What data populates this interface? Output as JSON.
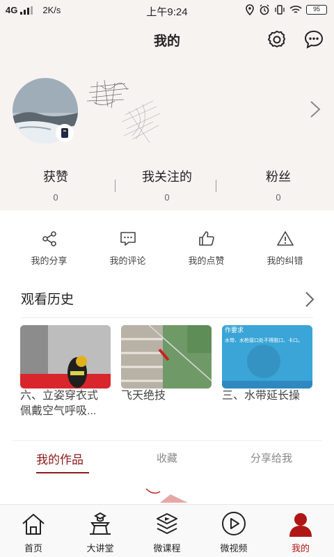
{
  "status_bar": {
    "network": "4G",
    "speed": "2K/s",
    "time": "上午9:24",
    "battery": "95"
  },
  "header": {
    "title": "我的",
    "icons": [
      "gear-icon",
      "message-icon"
    ]
  },
  "profile": {
    "stats": [
      {
        "label": "获赞",
        "value": "0"
      },
      {
        "label": "我关注的",
        "value": "0"
      },
      {
        "label": "粉丝",
        "value": "0"
      }
    ]
  },
  "actions": [
    {
      "label": "我的分享",
      "icon": "share-icon"
    },
    {
      "label": "我的评论",
      "icon": "comment-icon"
    },
    {
      "label": "我的点赞",
      "icon": "thumbs-up-icon"
    },
    {
      "label": "我的纠错",
      "icon": "warning-icon"
    }
  ],
  "history": {
    "title": "观看历史",
    "items": [
      {
        "title_line1": "六、立姿穿衣式",
        "title_line2": "佩戴空气呼吸..."
      },
      {
        "title_line1": "飞天绝技",
        "title_line2": ""
      },
      {
        "title_line1": "三、水带延长操",
        "title_line2": ""
      }
    ],
    "thumb_texts": [
      "作要求",
      "水带、水枪接口处不得脱口、卡口。"
    ]
  },
  "tabs": [
    {
      "label": "我的作品",
      "active": true
    },
    {
      "label": "收藏",
      "active": false
    },
    {
      "label": "分享给我",
      "active": false
    }
  ],
  "bottom_nav": [
    {
      "label": "首页",
      "icon": "home-icon",
      "active": false
    },
    {
      "label": "大讲堂",
      "icon": "lecture-hall-icon",
      "active": false
    },
    {
      "label": "微课程",
      "icon": "course-icon",
      "active": false
    },
    {
      "label": "微视频",
      "icon": "play-icon",
      "active": false
    },
    {
      "label": "我的",
      "icon": "user-icon",
      "active": true
    }
  ],
  "colors": {
    "accent": "#8b1a1a",
    "active_nav": "#b01515",
    "header_bg": "#f7f3f1"
  }
}
